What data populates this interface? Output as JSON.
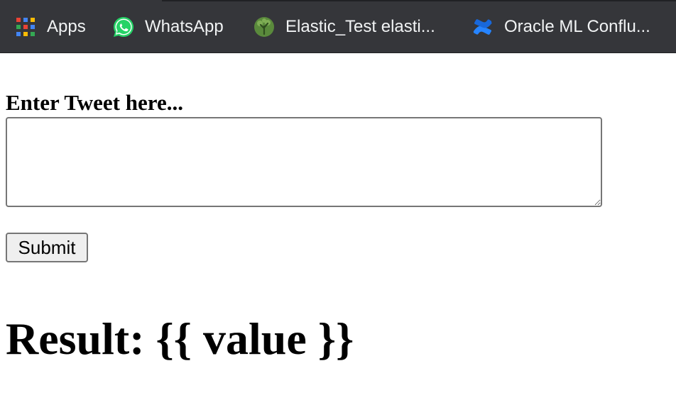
{
  "bookmarks": [
    {
      "label": "Apps",
      "icon": "apps-grid-icon"
    },
    {
      "label": "WhatsApp",
      "icon": "whatsapp-icon"
    },
    {
      "label": "Elastic_Test elasti...",
      "icon": "elastic-tree-icon"
    },
    {
      "label": "Oracle ML Conflu...",
      "icon": "confluence-icon"
    }
  ],
  "form": {
    "label": "Enter Tweet here...",
    "tweet_value": "",
    "submit_label": "Submit"
  },
  "result": {
    "text": "Result: {{ value }}"
  },
  "colors": {
    "bookmarks_bar": "#35363a",
    "bookmark_text": "#f1f3f4",
    "whatsapp_green": "#25d366",
    "elastic_green": "#5a8a3c",
    "confluence_blue": "#2684ff"
  }
}
